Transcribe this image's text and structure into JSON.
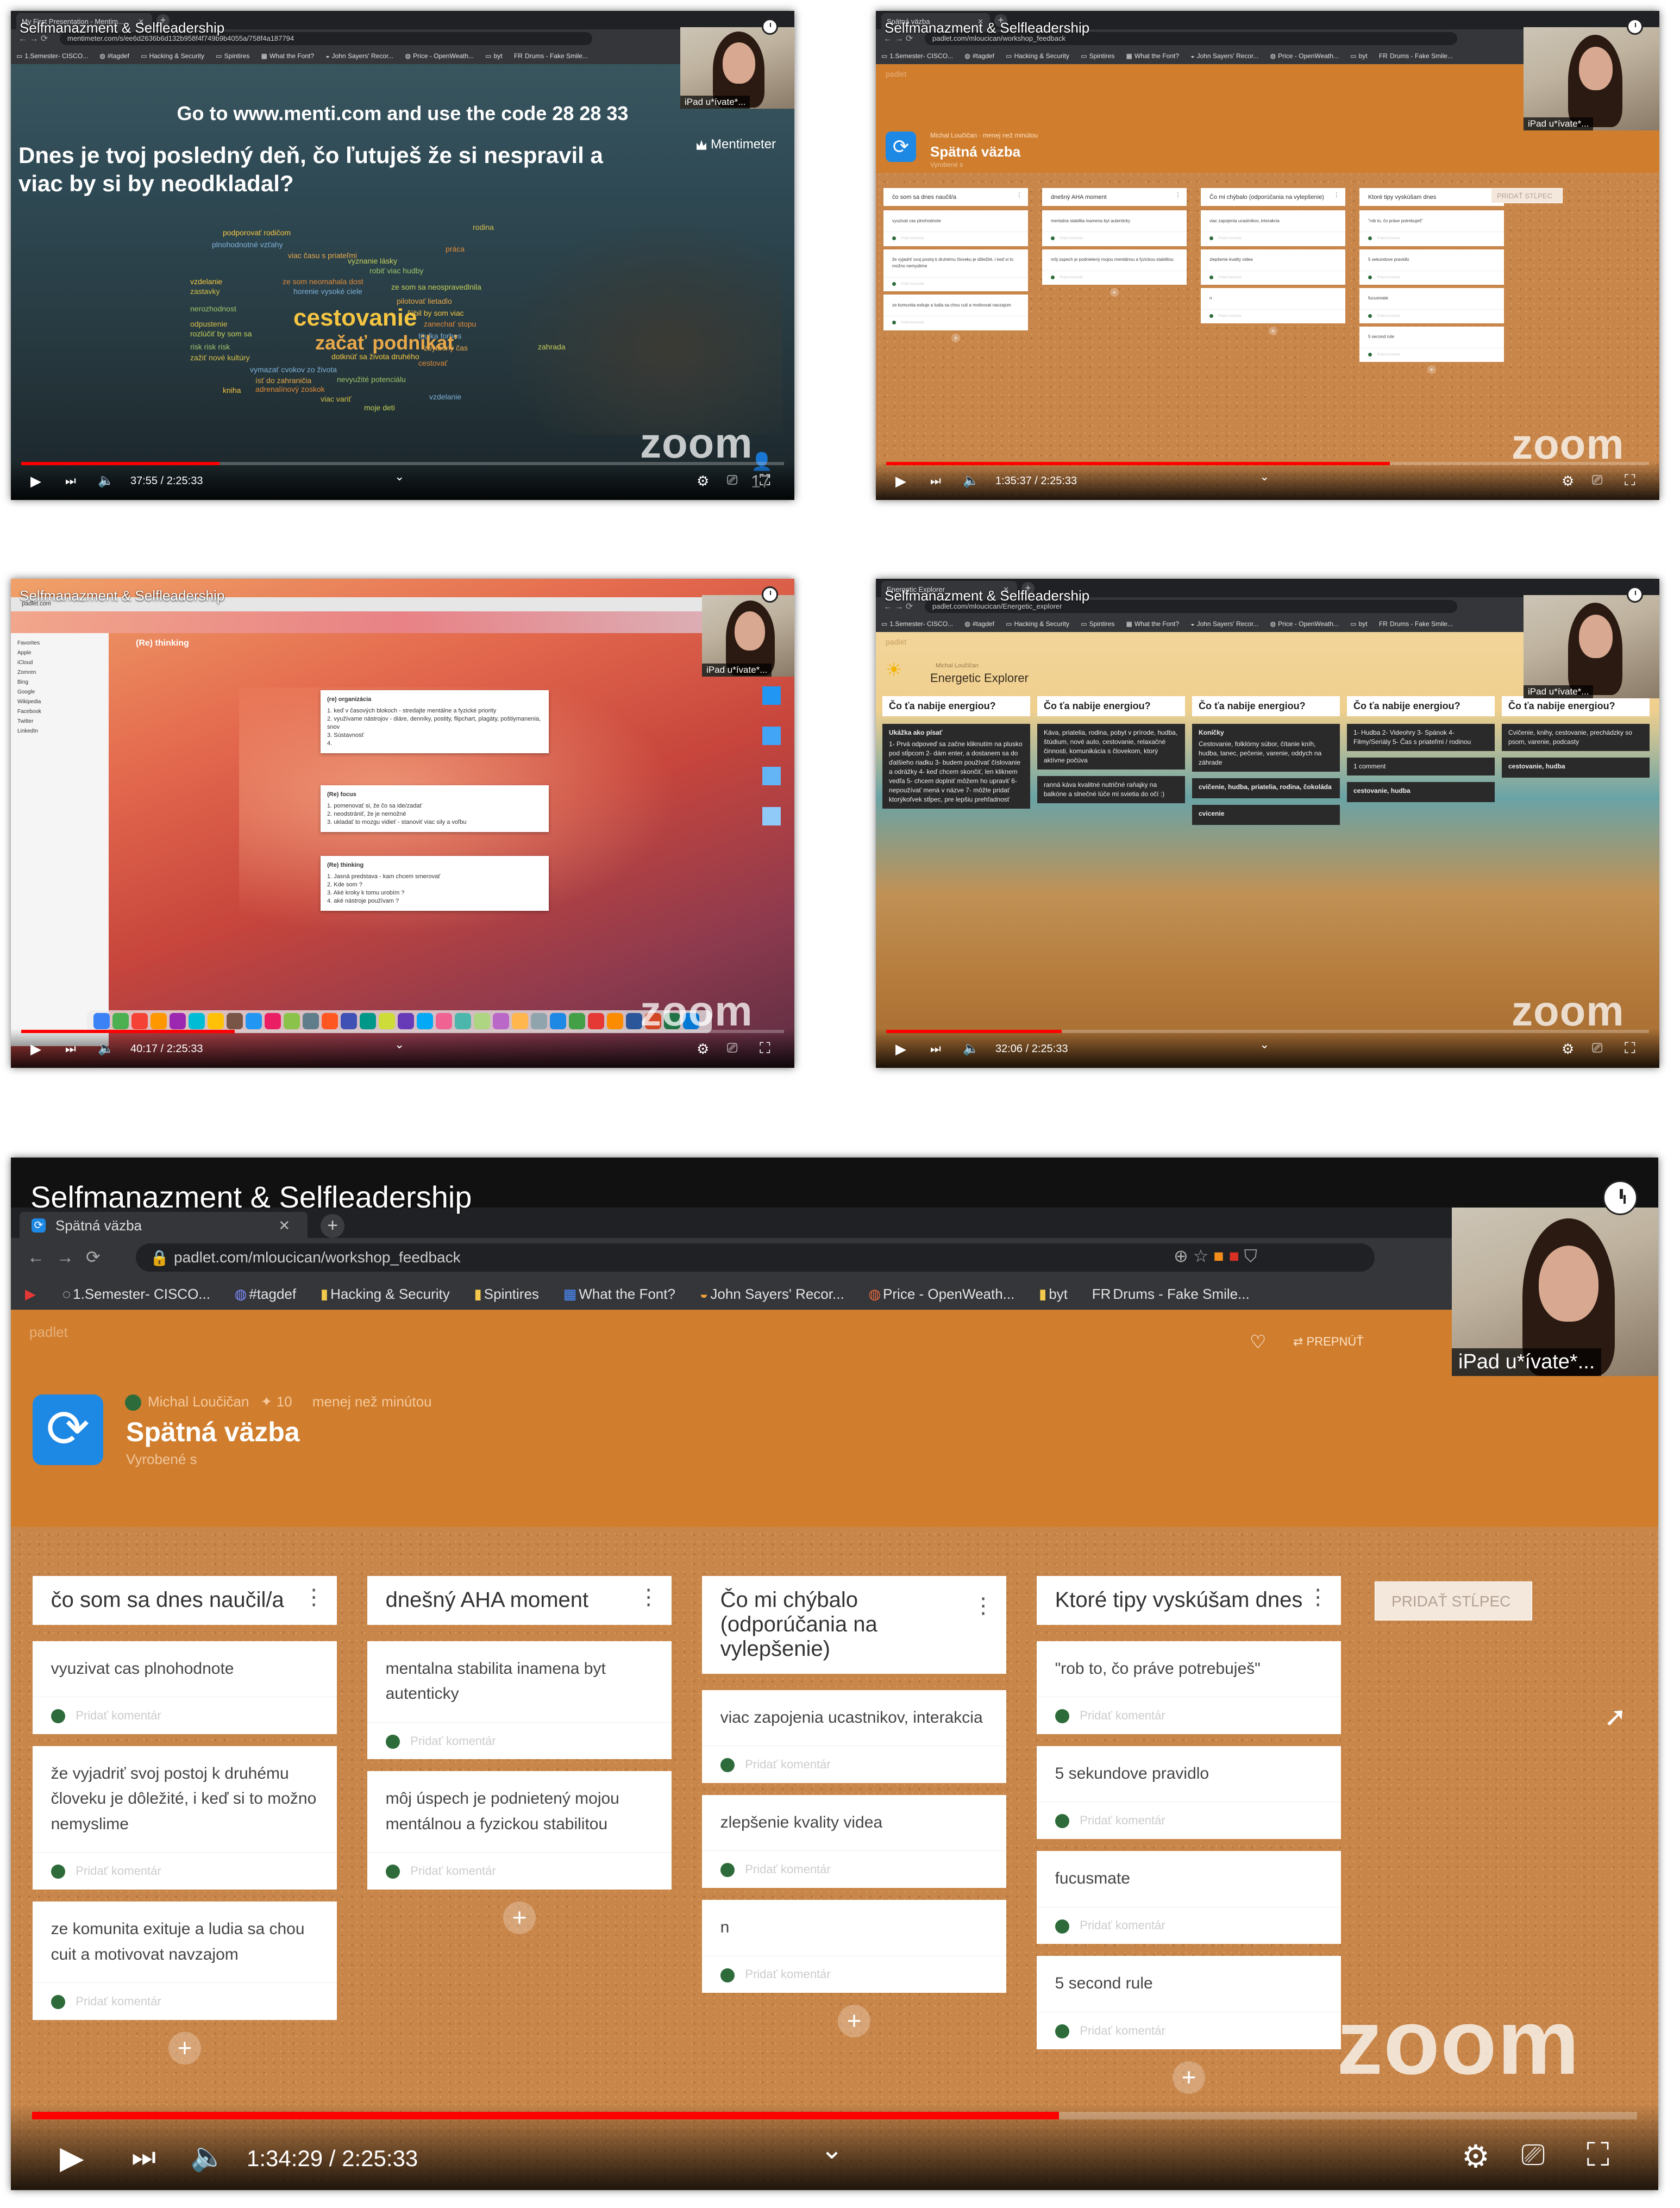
{
  "video_title": "Selfmanazment & Selfleadership",
  "camera_label": "iPad u*ívate*...",
  "zoom_logo": "zoom",
  "bookmarks": [
    "1.Semester- CISCO...",
    "#tagdef",
    "Hacking & Security",
    "Spintires",
    "What the Font?",
    "John Sayers' Recor...",
    "Price - OpenWeath...",
    "byt",
    "Drums - Fake Smile..."
  ],
  "padlet_brand": "padlet",
  "player": {
    "total": "2:25:33",
    "colors": {
      "progress": "#ff0000"
    }
  },
  "f1": {
    "tab": "My First Presentation - Mentim...",
    "url": "mentimeter.com/s/ee6d2636b6d132b958f4f749b9b4055a/758f4a187794",
    "code_line": "Go to www.menti.com and use the code 28 28 33",
    "question": "Dnes je tvoj posledný deň, čo ľutuješ že si nespravil a viac by si by neodkladal?",
    "brand": "Mentimeter",
    "big_words": [
      "cestovanie",
      "začať podnikať"
    ],
    "words": [
      "podporovať rodičom",
      "práca",
      "rodina",
      "plnohodnotné vzťahy",
      "vyznanie lásky",
      "viac času s priateľmi",
      "robiť viac hudby",
      "vzdelanie",
      "ze som neomahala dost",
      "zastavky",
      "horenie vysoké ciele",
      "ze som sa neospravedlnila",
      "pilotovať lietadlo",
      "nerozhodnost",
      "ľúbil by som viac",
      "zanechať stopu",
      "odpustenie",
      "titulka forbes",
      "rozlúčiť by som sa",
      "zbytočný čas",
      "risk risk risk",
      "dotknúť sa života druhého",
      "cestovať",
      "zažiť nové kultúry",
      "vymazať cvokov zo života",
      "zahrada",
      "ísť do zahraničia",
      "nevyužité potenciálu",
      "kniha",
      "adrenalínový zoskok",
      "viac variť",
      "vzdelanie",
      "moje deti"
    ],
    "participants": "17",
    "time": "37:55",
    "progress_pct": 26
  },
  "f2": {
    "tab": "Spätná väzba",
    "url": "padlet.com/mloucican/workshop_feedback",
    "author": "Michal Loučičan",
    "time_ago": "menej než minútou",
    "title": "Spätná väzba",
    "sub": "Vyrobené s",
    "time": "1:35:37",
    "progress_pct": 66
  },
  "f3": {
    "tab": "padlet.com",
    "board_title": "(Re) thinking",
    "cards": [
      {
        "title": "(re) organizácia",
        "lines": [
          "1. keď v časových blokoch - stredajte mentálne a fyzické priority",
          "2. využívame nástrojov - diáre, denníky, postity, flipchart, plagáty, poštiymanenia, snov",
          "3. Sústavnosť",
          "4."
        ]
      },
      {
        "title": "(Re) focus",
        "lines": [
          "1. pomenovať si, že čo sa ide/zadať",
          "2. neodstrániť, že je nemožné",
          "3. ukladať to mozgu vidieť - stanoviť viac sily a voľbu"
        ]
      },
      {
        "title": "(Re) thinking",
        "lines": [
          "1. Jasná predstava - kam chcem smerovať",
          "2. Kde som ?",
          "3. Aké kroky k tomu urobím ?",
          "4. aké nástroje používam ?"
        ]
      }
    ],
    "sidebar": [
      "Favorites",
      "Apple",
      "iCloud",
      "Zomren",
      "Bing",
      "Google",
      "Wikipedia",
      "Facebook",
      "Twitter",
      "LinkedIn"
    ],
    "time": "40:17",
    "progress_pct": 28
  },
  "f4": {
    "tab": "Energetic Explorer",
    "url": "padlet.com/mloucican/Energetic_explorer",
    "author": "Michal Loučičan",
    "title": "Energetic Explorer",
    "col_heading": "Čo ťa nabije energiou?",
    "cols": [
      [
        {
          "t": "Ukážka ako písať",
          "b": "1- Prvá odpoveď sa začne kliknutím na plusko pod stĺpcom 2- dám enter, a dostanem sa do ďalšieho riadku 3- budem používať číslovanie a odrážky 4- keď chcem skončiť, len kliknem vedľa 5- chcem doplniť môžem ho upraviť 6- nepoužívať mená v názve 7- môžte pridať ktorýkoľvek stĺpec, pre lepšiu prehľadnosť"
        }
      ],
      [
        {
          "t": "",
          "b": "Káva, priatelia, rodina, pobyt v prírode, hudba, štúdium, nové auto, cestovanie, relaxačné činnosti, komunikácia s človekom, ktorý aktívne počúva"
        },
        {
          "t": "",
          "b": "ranná káva kvalitné nutričné raňajky na balkóne a slnečné lúče mi svietia do očí :)"
        }
      ],
      [
        {
          "t": "Koníčky",
          "b": "Cestovanie, folklórny súbor, čítanie kníh, hudba, tanec, pečenie, varenie, oddych na záhrade"
        },
        {
          "t": "cvičenie, hudba, priatelia, rodina, čokoláda",
          "b": ""
        },
        {
          "t": "cvicenie",
          "b": ""
        }
      ],
      [
        {
          "t": "",
          "b": "1- Hudba 2- Videohry 3- Spánok 4- Filmy/Seriály 5- Čas s priateľmi / rodinou"
        },
        {
          "t": "",
          "b": "1 comment"
        },
        {
          "t": "cestovanie, hudba",
          "b": ""
        }
      ],
      [
        {
          "t": "",
          "b": "Cvičenie, knihy, cestovanie, prechádzky so psom, varenie, podcasty"
        },
        {
          "t": "cestovanie, hudba",
          "b": ""
        }
      ]
    ],
    "time": "32:06",
    "progress_pct": 23
  },
  "f5": {
    "tab": "Spätná väzba",
    "url": "padlet.com/mloucican/workshop_feedback",
    "author": "Michal Loučičan",
    "likes": "10",
    "time_ago": "menej než minútou",
    "title": "Spätná väzba",
    "sub": "Vyrobené s",
    "add_column": "PRIDAŤ STĹPEC",
    "comment_ph": "Pridať komentár",
    "prepnut": "PREPNÚŤ",
    "cols": [
      {
        "h": "čo som sa dnes naučil/a",
        "cards": [
          "vyuzivat cas plnohodnote",
          "že vyjadriť svoj postoj k druhému človeku je dôležité, i keď si to možno nemyslime",
          "ze komunita exituje a ludia sa chou cuit a motivovat navzajom"
        ]
      },
      {
        "h": "dnešný AHA moment",
        "cards": [
          "mentalna stabilita inamena byt autenticky",
          "môj úspech je podnietený mojou mentálnou a fyzickou stabilitou"
        ]
      },
      {
        "h": "Čo mi chýbalo (odporúčania na vylepšenie)",
        "cards": [
          "viac zapojenia ucastnikov, interakcia",
          "zlepšenie kvality videa",
          "n"
        ]
      },
      {
        "h": "Ktoré tipy vyskúšam dnes",
        "cards": [
          "\"rob to, čo práve potrebuješ\"",
          "5 sekundove pravidlo",
          "fucusmate",
          "5 second rule"
        ]
      }
    ],
    "time": "1:34:29",
    "progress_pct": 64
  }
}
